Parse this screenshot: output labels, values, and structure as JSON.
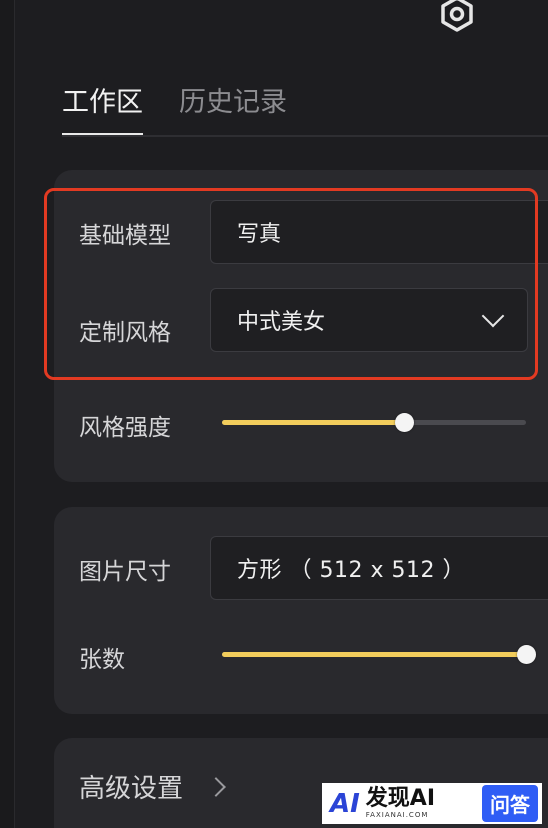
{
  "tabs": {
    "workspace": "工作区",
    "history": "历史记录"
  },
  "fields": {
    "base_model_label": "基础模型",
    "base_model_value": "写真",
    "custom_style_label": "定制风格",
    "custom_style_value": "中式美女",
    "style_strength_label": "风格强度",
    "style_strength_value": 0.6,
    "image_size_label": "图片尺寸",
    "image_size_value": "方形 （ 512 x 512 ）",
    "count_label": "张数",
    "count_value": 1.0
  },
  "advanced": {
    "label": "高级设置"
  },
  "watermark": {
    "logo": "AI",
    "main": "发现AI",
    "sub": "FAXIANAI.COM",
    "badge": "问答"
  },
  "icons": {
    "settings": "gear-icon",
    "dropdown": "chevron-down-icon",
    "expand": "chevron-right-icon"
  },
  "colors": {
    "accent_slider": "#f2cd5c",
    "highlight_border": "#e23a22"
  }
}
